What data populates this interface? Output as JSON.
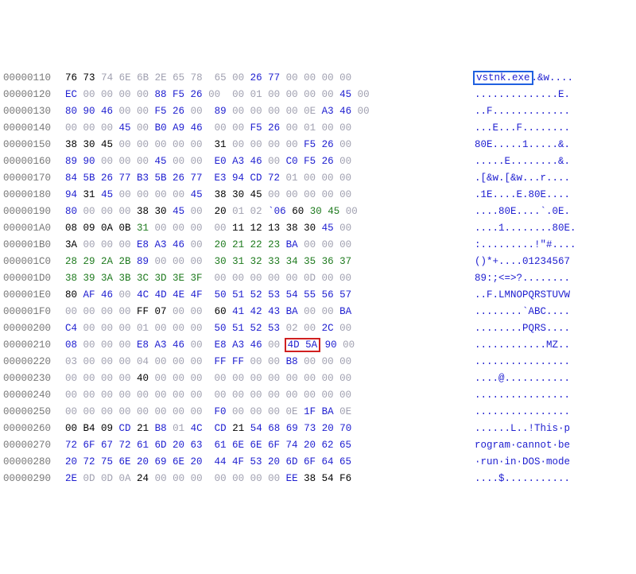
{
  "rows": [
    {
      "offset": "00000110",
      "hex": [
        {
          "t": "76",
          "c": "h-black"
        },
        {
          "t": " "
        },
        {
          "t": "73",
          "c": "h-black"
        },
        {
          "t": " "
        },
        {
          "t": "74 6E 6B 2E 65 78  65 00",
          "c": "h-gray"
        },
        {
          "t": " "
        },
        {
          "t": "26 77",
          "c": "h-blue"
        },
        {
          "t": " 00 00 00 00",
          "c": "h-gray"
        }
      ],
      "ascii": [
        {
          "t": "vstnk.exe",
          "box": "blue"
        },
        {
          "t": ".&w...."
        }
      ]
    },
    {
      "offset": "00000120",
      "hex": [
        {
          "t": "EC",
          "c": "h-blue"
        },
        {
          "t": " 00 00 00 00",
          "c": "h-gray"
        },
        {
          "t": " "
        },
        {
          "t": "88 F5 26",
          "c": "h-blue"
        },
        {
          "t": " 00  00 01 00 00 00 00 ",
          "c": "h-gray"
        },
        {
          "t": "45",
          "c": "h-blue"
        },
        {
          "t": " 00",
          "c": "h-gray"
        }
      ],
      "ascii": [
        {
          "t": "..............E."
        }
      ]
    },
    {
      "offset": "00000130",
      "hex": [
        {
          "t": "80 90 46",
          "c": "h-blue"
        },
        {
          "t": " 00 00",
          "c": "h-gray"
        },
        {
          "t": " "
        },
        {
          "t": "F5 26",
          "c": "h-blue"
        },
        {
          "t": " 00  ",
          "c": "h-gray"
        },
        {
          "t": "89",
          "c": "h-blue"
        },
        {
          "t": " 00 00 00 00 0E",
          "c": "h-gray"
        },
        {
          "t": " "
        },
        {
          "t": "A3 46",
          "c": "h-blue"
        },
        {
          "t": " 00",
          "c": "h-gray"
        }
      ],
      "ascii": [
        {
          "t": "..F............."
        }
      ]
    },
    {
      "offset": "00000140",
      "hex": [
        {
          "t": "00 00 00",
          "c": "h-gray"
        },
        {
          "t": " "
        },
        {
          "t": "45",
          "c": "h-blue"
        },
        {
          "t": " 00",
          "c": "h-gray"
        },
        {
          "t": " "
        },
        {
          "t": "B0 A9 46",
          "c": "h-blue"
        },
        {
          "t": "  00 00 ",
          "c": "h-gray"
        },
        {
          "t": "F5 26",
          "c": "h-blue"
        },
        {
          "t": " 00 01 00 00",
          "c": "h-gray"
        }
      ],
      "ascii": [
        {
          "t": "...E...F........"
        }
      ]
    },
    {
      "offset": "00000150",
      "hex": [
        {
          "t": "38 30 45",
          "c": "h-black"
        },
        {
          "t": " 00 00 00 00 00  ",
          "c": "h-gray"
        },
        {
          "t": "31",
          "c": "h-black"
        },
        {
          "t": " 00 00 00 00 ",
          "c": "h-gray"
        },
        {
          "t": "F5 26",
          "c": "h-blue"
        },
        {
          "t": " 00",
          "c": "h-gray"
        }
      ],
      "ascii": [
        {
          "t": "80E.....1.....&."
        }
      ]
    },
    {
      "offset": "00000160",
      "hex": [
        {
          "t": "89 90",
          "c": "h-blue"
        },
        {
          "t": " 00 00 00",
          "c": "h-gray"
        },
        {
          "t": " "
        },
        {
          "t": "45",
          "c": "h-blue"
        },
        {
          "t": " 00 00  ",
          "c": "h-gray"
        },
        {
          "t": "E0 A3 46",
          "c": "h-blue"
        },
        {
          "t": " 00",
          "c": "h-gray"
        },
        {
          "t": " "
        },
        {
          "t": "C0 F5 26",
          "c": "h-blue"
        },
        {
          "t": " 00",
          "c": "h-gray"
        }
      ],
      "ascii": [
        {
          "t": ".....E........&."
        }
      ]
    },
    {
      "offset": "00000170",
      "hex": [
        {
          "t": "84 5B 26 77 B3 5B 26 77  E3 94 CD 72",
          "c": "h-blue"
        },
        {
          "t": " 01 00 00 00",
          "c": "h-gray"
        }
      ],
      "ascii": [
        {
          "t": ".[&w.[&w...r...."
        }
      ]
    },
    {
      "offset": "00000180",
      "hex": [
        {
          "t": "94",
          "c": "h-blue"
        },
        {
          "t": " "
        },
        {
          "t": "31",
          "c": "h-black"
        },
        {
          "t": " "
        },
        {
          "t": "45",
          "c": "h-blue"
        },
        {
          "t": " 00 00 00 00 ",
          "c": "h-gray"
        },
        {
          "t": "45",
          "c": "h-blue"
        },
        {
          "t": "  "
        },
        {
          "t": "38 30 45",
          "c": "h-black"
        },
        {
          "t": " 00 00 00 00 00",
          "c": "h-gray"
        }
      ],
      "ascii": [
        {
          "t": ".1E....E.80E...."
        }
      ]
    },
    {
      "offset": "00000190",
      "hex": [
        {
          "t": "80",
          "c": "h-blue"
        },
        {
          "t": " 00 00 00",
          "c": "h-gray"
        },
        {
          "t": " "
        },
        {
          "t": "38 30",
          "c": "h-black"
        },
        {
          "t": " "
        },
        {
          "t": "45",
          "c": "h-blue"
        },
        {
          "t": " 00  ",
          "c": "h-gray"
        },
        {
          "t": "20",
          "c": "h-black"
        },
        {
          "t": " 01 02",
          "c": "h-gray"
        },
        {
          "t": " "
        },
        {
          "t": "`06",
          "c": "h-blue"
        },
        {
          "t": " "
        },
        {
          "t": "60",
          "c": "h-black"
        },
        {
          "t": " "
        },
        {
          "t": "30 45",
          "c": "h-green"
        },
        {
          "t": " 00",
          "c": "h-gray"
        }
      ],
      "ascii": [
        {
          "t": "....80E....`.0E."
        }
      ]
    },
    {
      "offset": "000001A0",
      "hex": [
        {
          "t": "08 09 0A 0B",
          "c": "h-black"
        },
        {
          "t": " "
        },
        {
          "t": "31",
          "c": "h-green"
        },
        {
          "t": " 00 00 00  00",
          "c": "h-gray"
        },
        {
          "t": " "
        },
        {
          "t": "11 12 13 38 30",
          "c": "h-black"
        },
        {
          "t": " "
        },
        {
          "t": "45",
          "c": "h-blue"
        },
        {
          "t": " 00",
          "c": "h-gray"
        }
      ],
      "ascii": [
        {
          "t": "....1........80E."
        }
      ]
    },
    {
      "offset": "000001B0",
      "hex": [
        {
          "t": "3A",
          "c": "h-black"
        },
        {
          "t": " 00 00 00",
          "c": "h-gray"
        },
        {
          "t": " "
        },
        {
          "t": "E8 A3 46",
          "c": "h-blue"
        },
        {
          "t": " 00  ",
          "c": "h-gray"
        },
        {
          "t": "20 21 22 23",
          "c": "h-green"
        },
        {
          "t": " "
        },
        {
          "t": "BA",
          "c": "h-blue"
        },
        {
          "t": " 00 00 00",
          "c": "h-gray"
        }
      ],
      "ascii": [
        {
          "t": ":.........!\"#...."
        }
      ]
    },
    {
      "offset": "000001C0",
      "hex": [
        {
          "t": "28 29 2A 2B",
          "c": "h-green"
        },
        {
          "t": " "
        },
        {
          "t": "89",
          "c": "h-blue"
        },
        {
          "t": " 00 00 00  ",
          "c": "h-gray"
        },
        {
          "t": "30 31 32 33 34 35 36 37",
          "c": "h-green"
        }
      ],
      "ascii": [
        {
          "t": "()*+....01234567"
        }
      ]
    },
    {
      "offset": "000001D0",
      "hex": [
        {
          "t": "38 39 3A 3B 3C 3D 3E 3F",
          "c": "h-green"
        },
        {
          "t": "  00 00 00 00 00 0D 00 00",
          "c": "h-gray"
        }
      ],
      "ascii": [
        {
          "t": "89:;<=>?........"
        }
      ]
    },
    {
      "offset": "000001E0",
      "hex": [
        {
          "t": "80",
          "c": "h-black"
        },
        {
          "t": " "
        },
        {
          "t": "AF 46",
          "c": "h-blue"
        },
        {
          "t": " 00",
          "c": "h-gray"
        },
        {
          "t": " "
        },
        {
          "t": "4C 4D 4E 4F  50 51 52 53 54 55 56 57",
          "c": "h-blue"
        }
      ],
      "ascii": [
        {
          "t": "..F.LMNOPQRSTUVW"
        }
      ]
    },
    {
      "offset": "000001F0",
      "hex": [
        {
          "t": "00 00 00 00",
          "c": "h-gray"
        },
        {
          "t": " "
        },
        {
          "t": "FF 07",
          "c": "h-black"
        },
        {
          "t": " 00 00  ",
          "c": "h-gray"
        },
        {
          "t": "60",
          "c": "h-black"
        },
        {
          "t": " "
        },
        {
          "t": "41 42 43 BA",
          "c": "h-blue"
        },
        {
          "t": " 00 00",
          "c": "h-gray"
        },
        {
          "t": " "
        },
        {
          "t": "BA",
          "c": "h-blue"
        }
      ],
      "ascii": [
        {
          "t": "........`ABC...."
        }
      ]
    },
    {
      "offset": "00000200",
      "hex": [
        {
          "t": "C4",
          "c": "h-blue"
        },
        {
          "t": " 00 00 00 01 00 00 00  ",
          "c": "h-gray"
        },
        {
          "t": "50 51 52 53",
          "c": "h-blue"
        },
        {
          "t": " 02 00",
          "c": "h-gray"
        },
        {
          "t": " "
        },
        {
          "t": "2C",
          "c": "h-blue"
        },
        {
          "t": " 00",
          "c": "h-gray"
        }
      ],
      "ascii": [
        {
          "t": "........PQRS...."
        }
      ]
    },
    {
      "offset": "00000210",
      "hex": [
        {
          "t": "08",
          "c": "h-blue"
        },
        {
          "t": " 00 00 00",
          "c": "h-gray"
        },
        {
          "t": " "
        },
        {
          "t": "E8 A3 46",
          "c": "h-blue"
        },
        {
          "t": " 00  ",
          "c": "h-gray"
        },
        {
          "t": "E8 A3 46",
          "c": "h-blue"
        },
        {
          "t": " 00 ",
          "c": "h-gray"
        },
        {
          "t": "4D 5A",
          "c": "h-blue",
          "box": "red"
        },
        {
          "t": " "
        },
        {
          "t": "90",
          "c": "h-blue"
        },
        {
          "t": " 00",
          "c": "h-gray"
        }
      ],
      "ascii": [
        {
          "t": "............MZ.."
        }
      ]
    },
    {
      "offset": "00000220",
      "hex": [
        {
          "t": "03 00 00 00 04 00 00 00  ",
          "c": "h-gray"
        },
        {
          "t": "FF FF",
          "c": "h-blue"
        },
        {
          "t": " 00 00",
          "c": "h-gray"
        },
        {
          "t": " "
        },
        {
          "t": "B8",
          "c": "h-blue"
        },
        {
          "t": " 00 00 00",
          "c": "h-gray"
        }
      ],
      "ascii": [
        {
          "t": "................"
        }
      ]
    },
    {
      "offset": "00000230",
      "hex": [
        {
          "t": "00 00 00 00",
          "c": "h-gray"
        },
        {
          "t": " "
        },
        {
          "t": "40",
          "c": "h-black"
        },
        {
          "t": " 00 00 00  00 00 00 00 00 00 00 00",
          "c": "h-gray"
        }
      ],
      "ascii": [
        {
          "t": "....@..........."
        }
      ]
    },
    {
      "offset": "00000240",
      "hex": [
        {
          "t": "00 00 00 00 00 00 00 00  00 00 00 00 00 00 00 00",
          "c": "h-gray"
        }
      ],
      "ascii": [
        {
          "t": "................"
        }
      ]
    },
    {
      "offset": "00000250",
      "hex": [
        {
          "t": "00 00 00 00 00 00 00 00  ",
          "c": "h-gray"
        },
        {
          "t": "F0",
          "c": "h-blue"
        },
        {
          "t": " 00 00 00 0E ",
          "c": "h-gray"
        },
        {
          "t": "1F BA",
          "c": "h-blue"
        },
        {
          "t": " 0E",
          "c": "h-gray"
        }
      ],
      "ascii": [
        {
          "t": "................"
        }
      ]
    },
    {
      "offset": "00000260",
      "hex": [
        {
          "t": "00 B4 09",
          "c": "h-black"
        },
        {
          "t": " "
        },
        {
          "t": "CD",
          "c": "h-blue"
        },
        {
          "t": " "
        },
        {
          "t": "21",
          "c": "h-black"
        },
        {
          "t": " "
        },
        {
          "t": "B8",
          "c": "h-blue"
        },
        {
          "t": " 01",
          "c": "h-gray"
        },
        {
          "t": " "
        },
        {
          "t": "4C",
          "c": "h-blue"
        },
        {
          "t": "  "
        },
        {
          "t": "CD",
          "c": "h-blue"
        },
        {
          "t": " "
        },
        {
          "t": "21",
          "c": "h-black"
        },
        {
          "t": " "
        },
        {
          "t": "54 68 69 73 20 70",
          "c": "h-blue"
        }
      ],
      "ascii": [
        {
          "t": "......L..!This·p"
        }
      ]
    },
    {
      "offset": "00000270",
      "hex": [
        {
          "t": "72 6F 67 72 61 6D 20 63  61 6E 6E 6F 74 20 62 65",
          "c": "h-blue"
        }
      ],
      "ascii": [
        {
          "t": "rogram·cannot·be"
        }
      ]
    },
    {
      "offset": "00000280",
      "hex": [
        {
          "t": "20 72 75 6E 20 69 6E 20  44 4F 53 20 6D 6F 64 65",
          "c": "h-blue"
        }
      ],
      "ascii": [
        {
          "t": "·run·in·DOS·mode"
        }
      ]
    },
    {
      "offset": "00000290",
      "hex": [
        {
          "t": "2E",
          "c": "h-blue"
        },
        {
          "t": " 0D 0D 0A",
          "c": "h-gray"
        },
        {
          "t": " "
        },
        {
          "t": "24",
          "c": "h-black"
        },
        {
          "t": " 00 00 00  00 00 00 00",
          "c": "h-gray"
        },
        {
          "t": " "
        },
        {
          "t": "EE",
          "c": "h-blue"
        },
        {
          "t": " "
        },
        {
          "t": "38 54 F6",
          "c": "h-black"
        }
      ],
      "ascii": [
        {
          "t": "....$..........."
        }
      ]
    }
  ]
}
